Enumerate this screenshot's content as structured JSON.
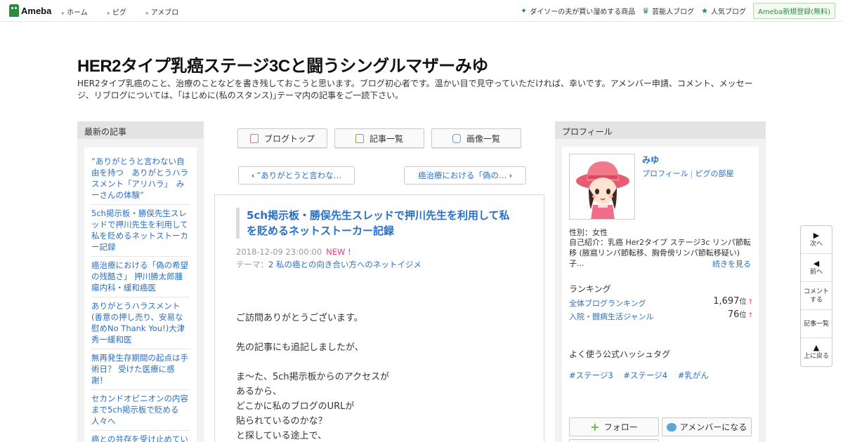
{
  "topbar": {
    "logo": "Ameba",
    "nav": [
      "ホーム",
      "ピグ",
      "アメブロ"
    ],
    "right_links": [
      "ダイソーの夫が買い溜めする商品",
      "芸能人ブログ",
      "人気ブログ"
    ],
    "register": "Ameba新規登録(無料)"
  },
  "header": {
    "title": "HER2タイプ乳癌ステージ3Cと闘うシングルマザーみゆ",
    "description": "HER2タイプ乳癌のこと、治療のことなどを書き残しておこうと思います。ブログ初心者です。温かい目で見守っていただければ、幸いです。アメンバー申請、コメント、メッセージ、リブログについては、｢はじめに(私のスタンス)｣テーマ内の記事をご一読下さい。"
  },
  "sidebar_left": {
    "heading": "最新の記事",
    "items": [
      "”ありがとうと言わない自由を持つ　ありがとうハラスメント「アリハラ」　みーさんの体験”",
      "5ch掲示板・勝俣先生スレッドで押川先生を利用して私を貶めるネットストーカー記録",
      "癌治療における「偽の希望の残酷さ」 押川勝太郎腫瘍内科・緩和癌医",
      "ありがとうハラスメント(善意の押し売り、安易な慰めNo Thank You!)大津秀一緩和医",
      "無再発生存期間の起点は手術日？ 受けた医療に感謝！",
      "セカンドオピニオンの内容まで5ch掲示板で貶める人々へ",
      "癌との共存を受け止めていること"
    ]
  },
  "center": {
    "nav_buttons": [
      "ブログトップ",
      "記事一覧",
      "画像一覧"
    ],
    "prev": "”ありがとうと言わな…",
    "next": "癌治療における「偽の…",
    "article": {
      "title": "5ch掲示板・勝俣先生スレッドで押川先生を利用して私を貶めるネットストーカー記録",
      "date": "2018-12-09 23:00:00",
      "new_badge": "NEW !",
      "theme_label": "テーマ：",
      "theme": "2 私の癌との向き合い方へのネットイジメ",
      "body": [
        "ご訪問ありがとうございます。",
        "",
        "先の記事にも追記しましたが、",
        "",
        "ま～た、5ch掲示板からのアクセスが",
        "あるから、",
        "どこかに私のブログのURLが",
        "貼られているのかな？",
        "と探している途上で、"
      ]
    }
  },
  "sidebar_right": {
    "heading": "プロフィール",
    "name": "みゆ",
    "link_profile": "プロフィール",
    "link_pig": "ピグの部屋",
    "gender": "性別：女性",
    "intro": "自己紹介：乳癌 Her2タイプ ステージ3c リンパ節転移 (腋窩リンパ節転移、胸骨傍リンパ節転移疑い) 子...",
    "more": "続きを見る",
    "ranking_heading": "ランキング",
    "rankings": [
      {
        "label": "全体ブログランキング",
        "value": "1,697",
        "unit": "位",
        "arrow": "↑"
      },
      {
        "label": "入院・闘病生活ジャンル",
        "value": "76",
        "unit": "位",
        "arrow": "↑"
      }
    ],
    "hashtag_heading": "よく使う公式ハッシュタグ",
    "hashtags": [
      "#ステージ3",
      "#ステージ4",
      "#乳がん"
    ],
    "follow": "フォロー",
    "member": "アメンバーになる"
  },
  "floatnav": {
    "items": [
      "次へ",
      "前へ",
      "コメントする",
      "記事一覧",
      "上に戻る"
    ]
  },
  "colors": {
    "brand_green": "#2d8c3c",
    "link_blue": "#2a6fc4",
    "new_pink": "#e83d74"
  }
}
